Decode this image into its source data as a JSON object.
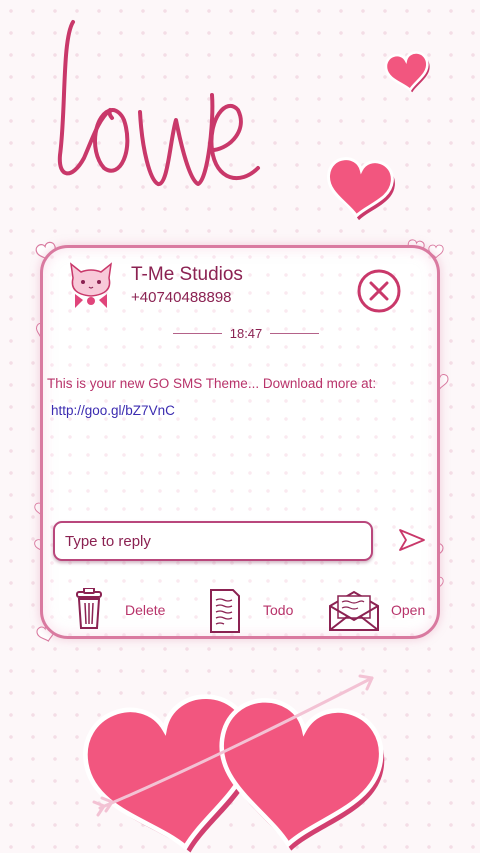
{
  "wallpaper": {
    "script_text": "love",
    "accent_color": "#f2567f",
    "outline_color": "#c9386a"
  },
  "header": {
    "avatar_icon": "kitten-avatar-icon",
    "sender_name": "T-Me Studios",
    "sender_number": "+40740488898",
    "close_icon": "close-circle-icon"
  },
  "message": {
    "time": "18:47",
    "text": "This is your new GO SMS Theme... Download more at:",
    "link": "http://goo.gl/bZ7VnC"
  },
  "reply": {
    "placeholder": "Type to reply",
    "send_icon": "send-arrow-icon"
  },
  "actions": [
    {
      "label": "Delete",
      "icon": "trash-icon"
    },
    {
      "label": "Todo",
      "icon": "note-icon"
    },
    {
      "label": "Open",
      "icon": "envelope-icon"
    }
  ]
}
